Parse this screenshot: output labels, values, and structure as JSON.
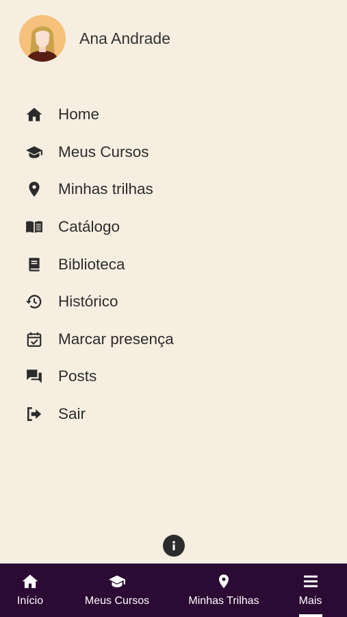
{
  "profile": {
    "name": "Ana Andrade",
    "avatar_icon": "user-avatar-female"
  },
  "menu": {
    "items": [
      {
        "label": "Home",
        "icon": "home-icon"
      },
      {
        "label": "Meus Cursos",
        "icon": "graduation-cap-icon"
      },
      {
        "label": "Minhas trilhas",
        "icon": "map-pin-icon"
      },
      {
        "label": "Catálogo",
        "icon": "open-book-icon"
      },
      {
        "label": "Biblioteca",
        "icon": "book-icon"
      },
      {
        "label": "Histórico",
        "icon": "history-icon"
      },
      {
        "label": "Marcar presença",
        "icon": "calendar-check-icon"
      },
      {
        "label": "Posts",
        "icon": "chat-icon"
      },
      {
        "label": "Sair",
        "icon": "sign-out-icon"
      }
    ]
  },
  "info_button": {
    "icon": "info-icon"
  },
  "bottom_nav": {
    "items": [
      {
        "label": "Início",
        "icon": "home-icon"
      },
      {
        "label": "Meus Cursos",
        "icon": "graduation-cap-icon"
      },
      {
        "label": "Minhas Trilhas",
        "icon": "map-pin-icon"
      },
      {
        "label": "Mais",
        "icon": "menu-icon",
        "active": true
      }
    ]
  },
  "colors": {
    "background": "#f5eee1",
    "nav_background": "#2b0a33",
    "text": "#2d2d2d",
    "avatar_bg": "#f6c17b"
  }
}
